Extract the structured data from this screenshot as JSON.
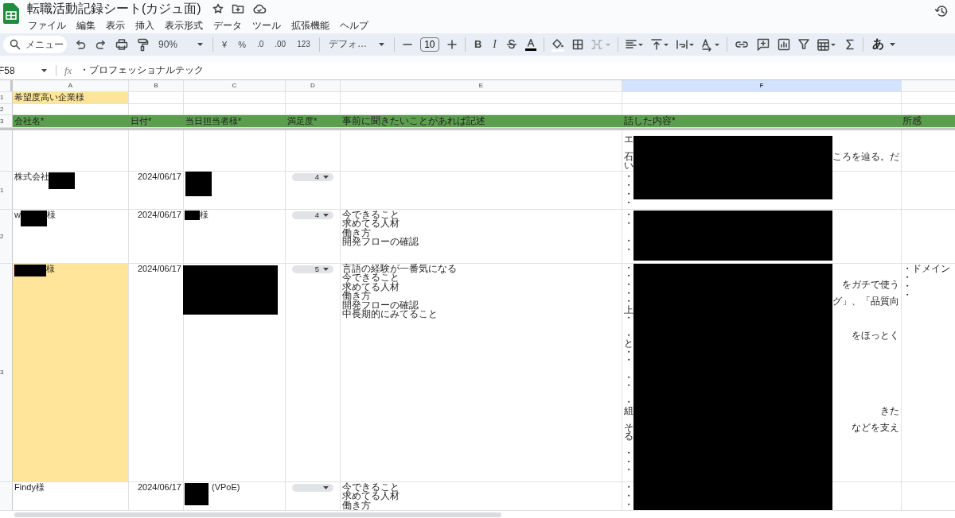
{
  "document": {
    "title": "転職活動記録シート(カジュ面)"
  },
  "menu": [
    "ファイル",
    "編集",
    "表示",
    "挿入",
    "表示形式",
    "データ",
    "ツール",
    "拡張機能",
    "ヘルプ"
  ],
  "toolbar": {
    "search_placeholder": "メニュー",
    "zoom": "90%",
    "currency": "¥",
    "percent": "%",
    "decrease_decimal": ".0",
    "increase_decimal": ".00",
    "number_format": "123",
    "font": "デフォ…",
    "font_size": "10",
    "bold": "B",
    "italic": "I",
    "input_tools": "あ",
    "merge_disabled": true
  },
  "formula_bar": {
    "cell_ref": "F58",
    "function_label": "fx",
    "formula": "・プロフェッショナルテック"
  },
  "columns": [
    {
      "label": "A",
      "selected": false
    },
    {
      "label": "B",
      "selected": false
    },
    {
      "label": "C",
      "selected": false
    },
    {
      "label": "D",
      "selected": false
    },
    {
      "label": "E",
      "selected": false
    },
    {
      "label": "F",
      "selected": true
    },
    {
      "selected": false
    }
  ],
  "redacted": true,
  "rows": [
    {
      "number": "1",
      "cells": [
        {
          "lines": [
            {
              "start": "希望度高い企業様"
            }
          ],
          "highlighted": true
        },
        {},
        {},
        {},
        {},
        {},
        {}
      ]
    },
    {
      "number": "2",
      "cells": [
        {},
        {},
        {},
        {},
        {},
        {},
        {}
      ]
    },
    {
      "number": "3",
      "kind": "header",
      "cells": [
        {
          "lines": [
            {
              "start": "会社名*"
            }
          ]
        },
        {
          "lines": [
            {
              "start": "日付*"
            }
          ]
        },
        {
          "lines": [
            {
              "start": "当日担当者様*"
            }
          ]
        },
        {
          "lines": [
            {
              "start": "満足度*"
            }
          ]
        },
        {
          "lines": [
            {
              "start": "事前に聞きたいことがあれば記述"
            }
          ]
        },
        {
          "lines": [
            {
              "start": "話した内容*"
            }
          ]
        },
        {
          "lines": [
            {
              "start": "所感"
            }
          ]
        }
      ]
    },
    {
      "kind": "frozen"
    },
    {
      "cells": [
        {},
        {},
        {},
        {},
        {},
        {
          "lines": [
            {
              "start": "エ"
            },
            {
              "start": "石",
              "end": "ころを辿る。だ",
              "gap_before": true
            },
            {
              "start": "い"
            }
          ]
        },
        {}
      ]
    },
    {
      "number": "1",
      "cells": [
        {
          "lines": [
            {
              "start": "株式会社",
              "redacted_after": true
            }
          ]
        },
        {
          "lines": [
            {
              "start": "2024/06/17"
            }
          ]
        },
        {},
        {
          "kind": "rating",
          "value": "4"
        },
        {},
        {
          "lines": [
            {
              "start": "・"
            },
            {
              "start": "・"
            },
            {
              "start": "・"
            },
            {
              "start": "・"
            }
          ]
        },
        {}
      ]
    },
    {
      "number": "2",
      "cells": [
        {
          "lines": [
            {
              "start": "w",
              "end": "様",
              "redacted_after": true
            }
          ]
        },
        {
          "lines": [
            {
              "start": "2024/06/17"
            }
          ]
        },
        {
          "lines": [
            {
              "start": "様",
              "redacted_before": true
            }
          ]
        },
        {
          "kind": "rating",
          "value": "4"
        },
        {
          "lines": [
            {
              "start": "今できること"
            },
            {
              "start": "求めてる人材"
            },
            {
              "start": "働き方"
            },
            {
              "start": "開発フローの確認"
            }
          ]
        },
        {
          "lines": [
            {
              "start": "・"
            },
            {
              "start": "・"
            },
            {
              "start": "・",
              "gap_before": true
            },
            {
              "start": "・"
            }
          ]
        },
        {}
      ]
    },
    {
      "number": "3",
      "cells": [
        {
          "lines": [
            {
              "start": "様",
              "redacted_before": true
            }
          ],
          "highlighted": true
        },
        {
          "lines": [
            {
              "start": "2024/06/17"
            }
          ]
        },
        {},
        {
          "kind": "rating",
          "value": "5"
        },
        {
          "lines": [
            {
              "start": "言語の経験が一番気になる"
            },
            {
              "start": "今できること"
            },
            {
              "start": "求めてる人材"
            },
            {
              "start": "働き方"
            },
            {
              "start": "開発フローの確認"
            },
            {
              "start": "中長期的にみてること"
            }
          ]
        },
        {
          "lines": [
            {
              "start": "・"
            },
            {
              "start": "・"
            },
            {
              "start": "・",
              "end": "をガチで使う"
            },
            {
              "start": "・"
            },
            {
              "start": "・",
              "end": "グ」、「品質向"
            },
            {
              "start": "上"
            },
            {
              "start": "・"
            },
            {
              "start": "・",
              "end": "をほっとく",
              "gap_before": true
            },
            {
              "start": "と"
            },
            {
              "start": "・"
            },
            {
              "start": "・"
            },
            {
              "start": "・",
              "gap_before": true
            },
            {
              "start": "・"
            },
            {
              "start": "・",
              "gap_before": true
            },
            {
              "start": "組",
              "end": "きた"
            },
            {
              "start": "そ",
              "end": "などを支え",
              "gap_before": true
            },
            {
              "start": "る"
            },
            {
              "start": "・",
              "gap_before": true
            },
            {
              "start": "・"
            },
            {
              "start": "・"
            }
          ]
        },
        {
          "lines": [
            {
              "start": "・ドメイン"
            },
            {
              "start": "・"
            },
            {
              "start": "・"
            },
            {
              "start": "・"
            }
          ]
        }
      ]
    },
    {
      "cells": [
        {
          "lines": [
            {
              "start": "Findy様"
            }
          ]
        },
        {
          "lines": [
            {
              "start": "2024/06/17"
            }
          ]
        },
        {
          "lines": [
            {
              "start": "(VPoE)",
              "redacted_before": true
            }
          ]
        },
        {
          "kind": "rating"
        },
        {
          "lines": [
            {
              "start": "今できること"
            },
            {
              "start": "求めてる人材"
            },
            {
              "start": "働き方"
            }
          ]
        },
        {
          "lines": [
            {
              "start": "・"
            },
            {
              "start": "・"
            },
            {
              "start": "・"
            }
          ]
        },
        {}
      ]
    }
  ]
}
